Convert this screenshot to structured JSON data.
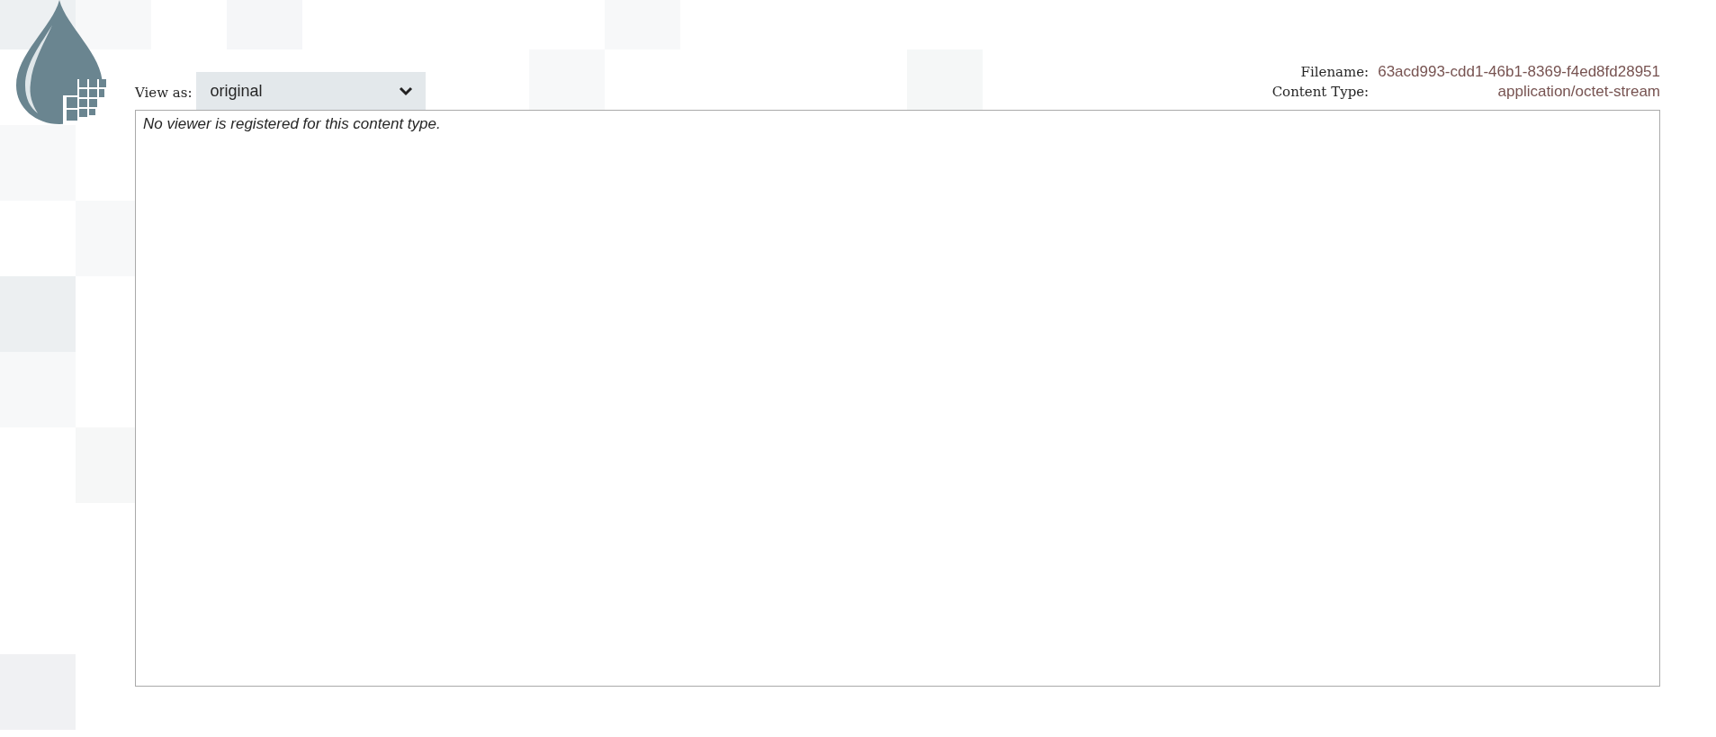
{
  "view_as": {
    "label": "View as:",
    "value": "original"
  },
  "file_info": [
    {
      "label": "Filename:",
      "value": "63acd993-cdd1-46b1-8369-f4ed8fd28951"
    },
    {
      "label": "Content Type:",
      "value": "application/octet-stream"
    }
  ],
  "content": {
    "message": "No viewer is registered for this content type."
  }
}
